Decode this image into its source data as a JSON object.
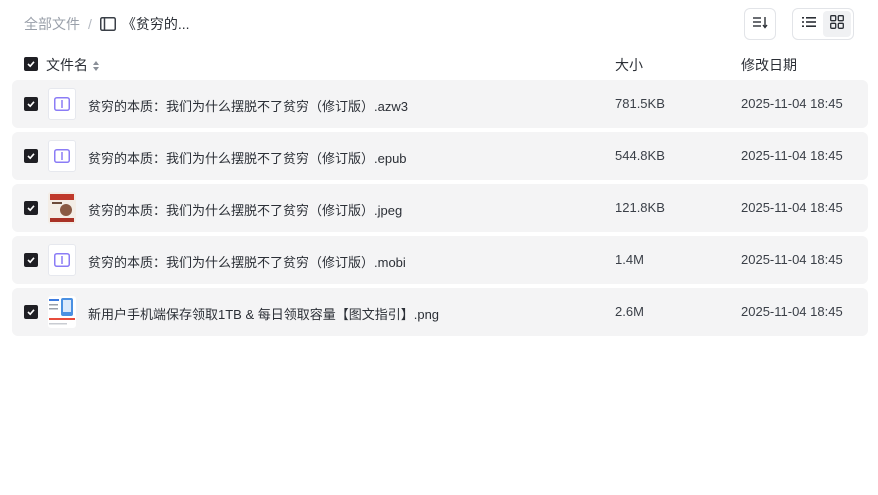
{
  "breadcrumb": {
    "root": "全部文件",
    "separator": "/",
    "current": "《贫穷的..."
  },
  "toolbar": {
    "sort_icon": "sort-lines-icon",
    "list_view_icon": "list-view-icon",
    "grid_view_icon": "grid-view-icon"
  },
  "table": {
    "header": {
      "name": "文件名",
      "size": "大小",
      "date": "修改日期"
    },
    "rows": [
      {
        "name": "贫穷的本质：我们为什么摆脱不了贫穷（修订版）.azw3",
        "size": "781.5KB",
        "date": "2025-11-04 18:45",
        "thumb": "book"
      },
      {
        "name": "贫穷的本质：我们为什么摆脱不了贫穷（修订版）.epub",
        "size": "544.8KB",
        "date": "2025-11-04 18:45",
        "thumb": "book"
      },
      {
        "name": "贫穷的本质：我们为什么摆脱不了贫穷（修订版）.jpeg",
        "size": "121.8KB",
        "date": "2025-11-04 18:45",
        "thumb": "image-cover"
      },
      {
        "name": "贫穷的本质：我们为什么摆脱不了贫穷（修订版）.mobi",
        "size": "1.4M",
        "date": "2025-11-04 18:45",
        "thumb": "book"
      },
      {
        "name": "新用户手机端保存领取1TB & 每日领取容量【图文指引】.png",
        "size": "2.6M",
        "date": "2025-11-04 18:45",
        "thumb": "image-guide"
      }
    ]
  },
  "colors": {
    "row_bg": "#f4f4f5",
    "checkbox": "#1f1f24",
    "book_icon": "#8b7cf6"
  }
}
